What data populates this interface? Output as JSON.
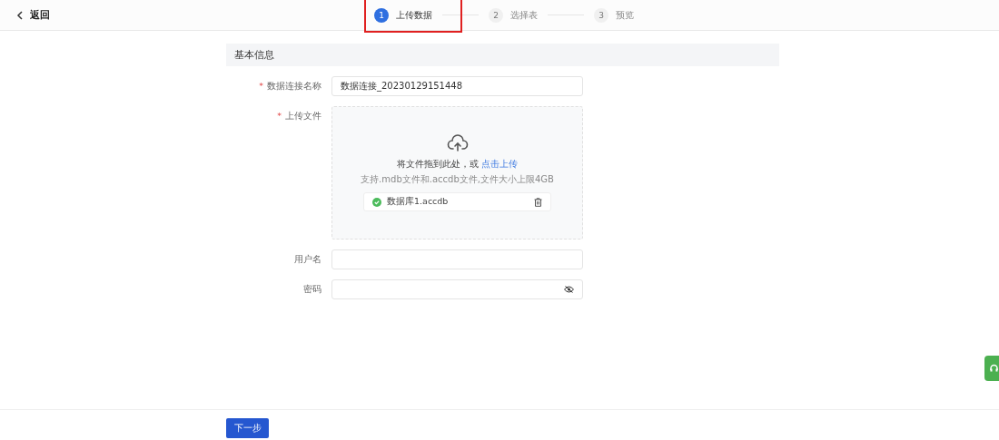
{
  "header": {
    "back_label": "返回"
  },
  "steps": [
    {
      "number": "1",
      "label": "上传数据",
      "selected": true,
      "highlighted": true
    },
    {
      "number": "2",
      "label": "选择表",
      "selected": false,
      "highlighted": false
    },
    {
      "number": "3",
      "label": "预览",
      "selected": false,
      "highlighted": false
    }
  ],
  "section": {
    "title": "基本信息"
  },
  "form": {
    "required_marker": "*",
    "name": {
      "label": "数据连接名称",
      "required": true,
      "value": "数据连接_20230129151448"
    },
    "upload": {
      "label": "上传文件",
      "required": true,
      "prompt": "将文件拖到此处，或",
      "link": "点击上传",
      "hint": "支持.mdb文件和.accdb文件,文件大小上限4GB",
      "files": [
        {
          "name": "数据库1.accdb",
          "kind": "success"
        }
      ]
    },
    "username": {
      "label": "用户名",
      "required": false
    },
    "password": {
      "label": "密码",
      "required": false
    }
  },
  "footer": {
    "next_button": "下一步"
  }
}
